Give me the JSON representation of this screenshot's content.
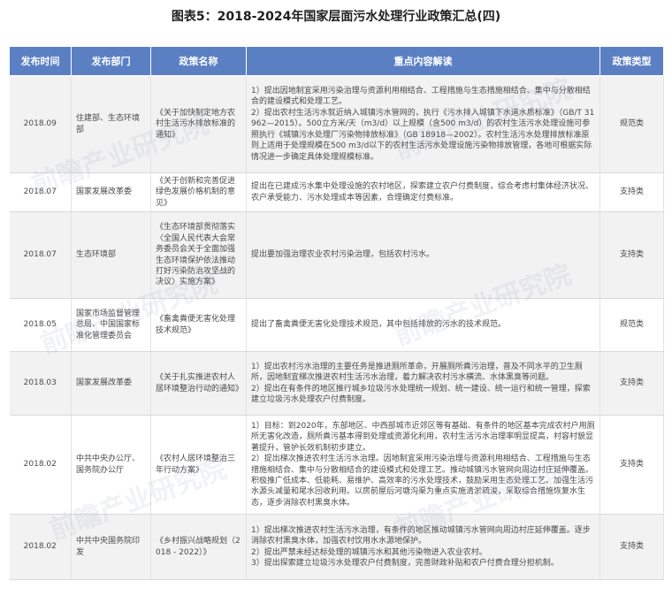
{
  "title": "图表5：2018-2024年国家层面污水处理行业政策汇总(四)",
  "headers": [
    "发布时间",
    "发布部门",
    "政策名称",
    "重点内容解读",
    "政策类型"
  ],
  "watermark": "前瞻产业研究院",
  "rows": [
    {
      "date": "2018.09",
      "dept": "住建部、生态环境部",
      "name": "《关于加快制定地方农村生活污水排放标准的通知》",
      "content": "1）提出因地制宜采用污染治理与资源利用相结合、工程措施与生态措施相结合、集中与分散相结合的建设模式和处理工艺。\n2）提出农村生活污水就近纳入城镇污水管网的，执行《污水排入城镇下水道水质标准》（GB/T 31962—2015）。500立方米/天（m3/d）以上规模（含500 m3/d）的农村生活污水处理设施可参照执行《城镇污水处理厂污染物排放标准》（GB 18918—2002）。农村生活污水处理排放标准原则上适用于处理规模在500 m3/d以下的农村生活污水处理设施污染物排放管理，各地可根据实际情况进一步确定具体处理规模标准。",
      "type": "规范类"
    },
    {
      "date": "2018.07",
      "dept": "国家发展改革委",
      "name": "《关于创新和完善促进绿色发展价格机制的意见》",
      "content": "提出在已建成污水集中处理设施的农村地区，探索建立农户付费制度，综合考虑村集体经济状况、农户承受能力、污水处理成本等因素，合理确定付费标准。",
      "type": "支持类"
    },
    {
      "date": "2018.07",
      "dept": "生态环境部",
      "name": "《生态环境部贯彻落实〈全国人民代表大会常务委员会关于全面加强生态环境保护依法推动打好污染防治攻坚战的决议〉实施方案》",
      "content": "提出要加强治理农业农村污染治理，包括农村污水。",
      "type": "支持类"
    },
    {
      "date": "2018.05",
      "dept": "国家市场监督管理总局、中国国家标准化管理委员会",
      "name": "《畜禽粪便无害化处理技术规范》",
      "content": "提出了畜禽粪便无害化处理技术规范，其中包括排放的污水的技术规范。",
      "type": "规范类"
    },
    {
      "date": "2018.03",
      "dept": "国家发展改革委",
      "name": "《关于扎实推进农村人居环境整治行动的通知》",
      "content": "1）提出农村污水治理的主要任务是推进厕所革命，开展厕所粪污治理，普及不同水平的卫生厕所，因地制宜梯次推进农村生活污水治理，着力解决农村污水横流、水体黑臭等问题。\n2）提出在有条件的地区推行城乡垃圾污水处理统一规划、统一建设、统一运行和统一管理，探索建立垃圾污水处理农户付费制度。",
      "type": "支持类"
    },
    {
      "date": "2018.02",
      "dept": "中共中央办公厅、国务院办公厅",
      "name": "《农村人居环境整治三年行动方案》",
      "content": "1）目标：到2020年，东部地区、中西部城市近郊区等有基础、有条件的地区基本完成农村户用厕所无害化改造，厕所粪污基本得到处理或资源化利用，农村生活污水治理率明显提高，村容村貌显著提升，管护长效机制初步建立。\n2）提出梯次推进农村生活污水治理。因地制宜采用污染治理与资源利用相结合、工程措施与生态措施相结合、集中与分散相结合的建设模式和处理工艺。推动城镇污水管网向周边村庄延伸覆盖。积极推广低成本、低能耗、易维护、高效率的污水处理技术，鼓励采用生态处理工艺。加强生活污水源头减量和尾水回收利用。以房前屋后河塘沟渠为重点实施清淤疏浚，采取综合措施恢复水生态，逐步消除农村黑臭水体。",
      "type": "支持类"
    },
    {
      "date": "2018.02",
      "dept": "中共中央国务院印发",
      "name": "《乡村振兴战略规划（2018 - 2022）》",
      "content": "1）提出梯次推进农村生活污水治理，有条件的地区推动城镇污水管网向周边村庄延伸覆盖。逐步消除农村黑臭水体，加强农村饮用水水源地保护。\n2）提出严禁未经达标处理的城镇污水和其他污染物进入农业农村。\n3）提出探索建立垃圾污水处理农户付费制度，完善财政补贴和农户付费合理分担机制。",
      "type": "支持类"
    }
  ]
}
